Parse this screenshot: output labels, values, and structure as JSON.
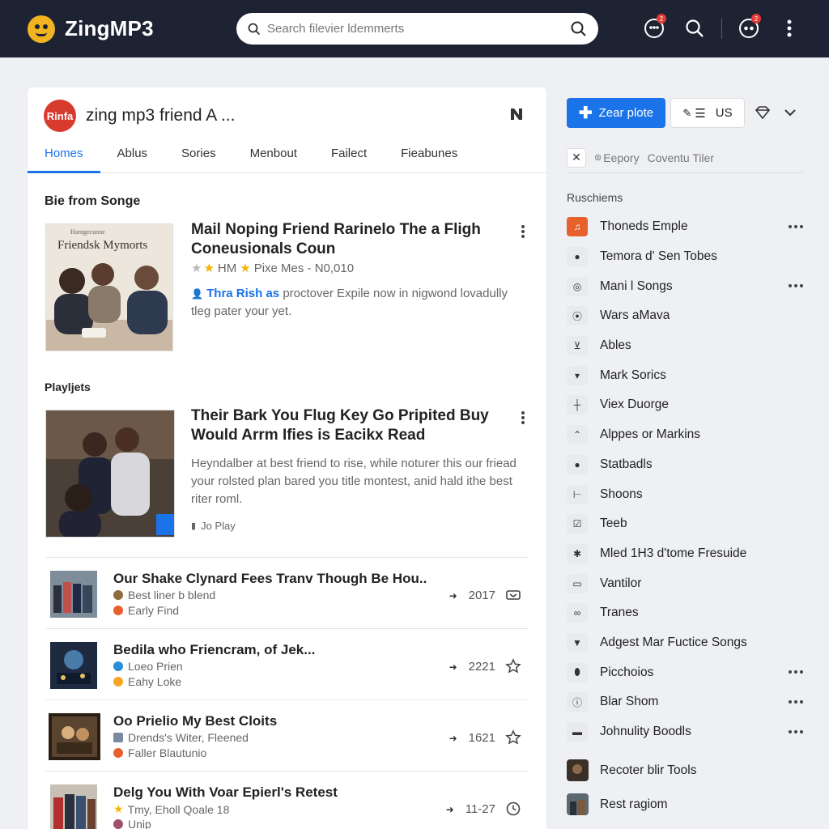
{
  "app": {
    "name": "ZingMP3",
    "search_placeholder": "Search filevier ldemmerts",
    "badge_1": "2",
    "badge_2": "2"
  },
  "channel": {
    "avatar_text": "Rinfa",
    "title": "zing mp3 friend A ..."
  },
  "tabs": [
    "Homes",
    "Ablus",
    "Sories",
    "Menbout",
    "Failect",
    "Fieabunes"
  ],
  "section1": "Bie from Songe",
  "feature1": {
    "title": "Mail Noping Friend Rarinelo The a Fligh Coneusionals Coun",
    "meta": "HM",
    "meta2": "Pixe Mes - N0,010",
    "desc_highlight": "Thra Rish as",
    "desc_rest": "proctover Expile now in nigwond lovadully tleg pater your yet.",
    "thumb_text": "Friendsk Mymorts",
    "thumb_small": "Harngecuone"
  },
  "section2": "Playljets",
  "feature2": {
    "title": "Their Bark You Flug Key Go Pripited Buy Would Arrm Ifies is Eacikx Read",
    "desc": "Heyndalber at best friend to rise, while noturer this our friead your rolsted plan bared you title montest, anid hald ithe best riter roml.",
    "play": "Jo Play"
  },
  "songs": [
    {
      "title": "Our Shake Clynard Fees Tranv Though Be Hou..",
      "sub1": "Best liner b blend",
      "sub2": "Early Find",
      "year": "2017",
      "c1": "#8a6d3b",
      "c2": "#e8602c"
    },
    {
      "title": "Bedila who Friencram, of Jek...",
      "sub1": "Loeo Prien",
      "sub2": "Eahy Loke",
      "year": "2221",
      "c1": "#2a8fd8",
      "c2": "#f5a623"
    },
    {
      "title": "Oo Prielio My Best Cloits",
      "sub1": "Drends's Witer, Fleened",
      "sub2": "Faller Blautunio",
      "year": "1621",
      "c1": "#7a8aa0",
      "c2": "#e8602c"
    },
    {
      "title": "Delg You With Voar Epierl's Retest",
      "sub1": "Tmy, Eholl Qoale 18",
      "sub2": "Unip",
      "year": "11-27",
      "c1": "#f5b400",
      "c2": "#a0506a"
    }
  ],
  "right": {
    "primary_btn": "Zear plote",
    "us_btn": "US",
    "filter_text": "Eepory",
    "filter_text2": "Coventu Tiler",
    "heading": "Ruschiems",
    "items": [
      {
        "label": "Thoneds Emple",
        "more": true,
        "icon": "music-note",
        "red": true
      },
      {
        "label": "Temora d' Sen Tobes",
        "more": false,
        "icon": "person"
      },
      {
        "label": "Mani l Songs",
        "more": true,
        "icon": "disc"
      },
      {
        "label": "Wars aMava",
        "more": false,
        "icon": "target"
      },
      {
        "label": "Ables",
        "more": false,
        "icon": "filter"
      },
      {
        "label": "Mark Sorics",
        "more": false,
        "icon": "bookmark"
      },
      {
        "label": "Viex Duorge",
        "more": false,
        "icon": "slider"
      },
      {
        "label": "Alppes or Markins",
        "more": false,
        "icon": "up"
      },
      {
        "label": "Statbadls",
        "more": false,
        "icon": "person"
      },
      {
        "label": "Shoons",
        "more": false,
        "icon": "line"
      },
      {
        "label": "Teeb",
        "more": false,
        "icon": "check"
      },
      {
        "label": "Mled 1H3 d'tome Fresuide",
        "more": false,
        "icon": "sparkle"
      },
      {
        "label": "Vantilor",
        "more": false,
        "icon": "box"
      },
      {
        "label": "Tranes",
        "more": false,
        "icon": "link"
      },
      {
        "label": "Adgest Mar Fuctice Songs",
        "more": false,
        "icon": "down"
      },
      {
        "label": "Picchoios",
        "more": true,
        "icon": "pin"
      },
      {
        "label": "Blar Shom",
        "more": true,
        "icon": "info"
      },
      {
        "label": "Johnulity Boodls",
        "more": true,
        "icon": "card"
      }
    ],
    "bottom": [
      "Recoter blir Tools",
      "Rest ragiom"
    ]
  },
  "colors": {
    "accent": "#1a73e8",
    "topbar": "#1e2333",
    "brand_logo": "#f2b321"
  }
}
